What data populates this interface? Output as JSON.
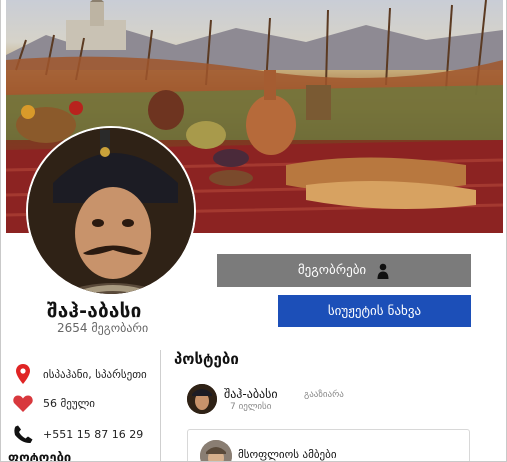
{
  "profile": {
    "name": "შაჰ-აბასი",
    "friends_count": "2654 მეგობარი"
  },
  "actions": {
    "friends_label": "მეგობრები",
    "stories_label": "სიუჟეტის ნახვა"
  },
  "info": {
    "location": "ისპაჰანი, სპარსეთი",
    "likes": "56 მეული",
    "phone": "+551 15 87 16 29"
  },
  "sections": {
    "photos_title": "ფოტოები",
    "posts_title": "პოსტები"
  },
  "post": {
    "author": "შაჰ-აბასი",
    "action": "გააზიარა",
    "time": "7 იელისი",
    "shared_title": "მსოფლიოს ამბები"
  },
  "colors": {
    "stories_button": "#1c4fb8",
    "friends_button": "#7b7b7b",
    "location_icon": "#e02424",
    "heart_icon": "#d8383d"
  },
  "icons": [
    "location-pin-icon",
    "heart-icon",
    "phone-icon",
    "person-icon"
  ]
}
